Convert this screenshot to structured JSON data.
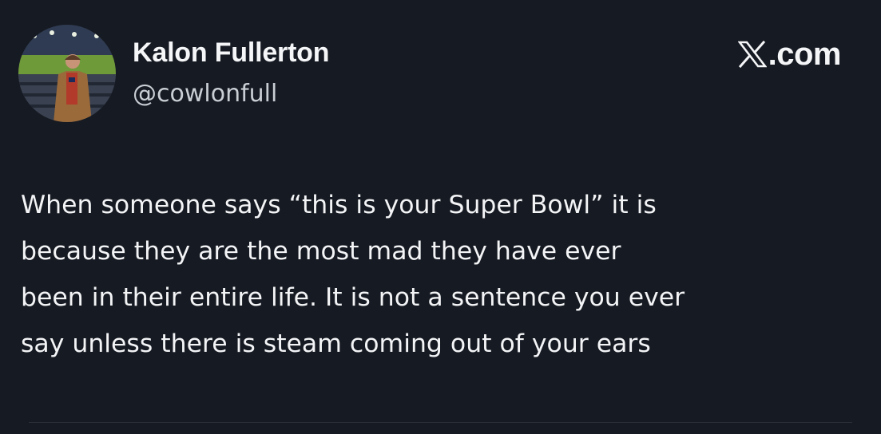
{
  "author": {
    "display_name": "Kalon Fullerton",
    "handle": "@cowlonfull",
    "avatar_icon": "profile-photo"
  },
  "brand": {
    "logo_icon": "x-logo-icon",
    "text": ".com"
  },
  "tweet": {
    "lines": [
      "When someone says “this is your Super Bowl” it is",
      "because they are the most mad they have ever",
      "been in their entire life. It is not a sentence you ever",
      "say unless there is steam coming out of your ears"
    ]
  },
  "colors": {
    "background": "#161a22",
    "text_primary": "#f3f4f6",
    "text_secondary": "#c9cdd4"
  }
}
